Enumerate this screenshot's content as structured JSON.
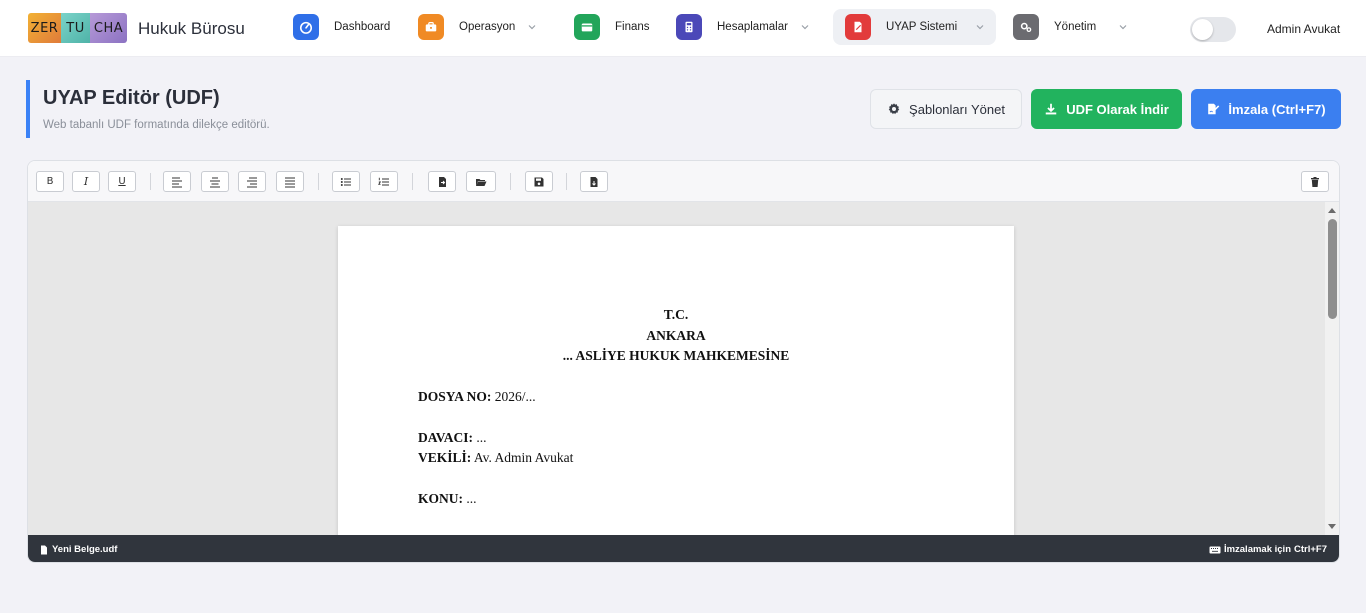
{
  "app": {
    "logo_parts": [
      "ZER",
      "TU",
      "CHA"
    ],
    "brand": "Hukuk Bürosu"
  },
  "nav": [
    {
      "label": "Dashboard",
      "icon": "gauge-icon",
      "color": "#2f6fe8",
      "dropdown": false
    },
    {
      "label": "Operasyon",
      "icon": "briefcase-icon",
      "color": "#f08a24",
      "dropdown": true
    },
    {
      "label": "Finans",
      "icon": "wallet-icon",
      "color": "#22a55a",
      "dropdown": false
    },
    {
      "label": "Hesaplamalar",
      "icon": "calculator-icon",
      "color": "#4b48b8",
      "dropdown": true
    },
    {
      "label": "UYAP Sistemi",
      "icon": "file-signature-icon",
      "color": "#e23b3b",
      "dropdown": true,
      "active": true
    },
    {
      "label": "Yönetim",
      "icon": "cogs-icon",
      "color": "#6b6b70",
      "dropdown": true
    }
  ],
  "user": {
    "name": "Admin Avukat",
    "theme_toggle_on": false
  },
  "page": {
    "title": "UYAP Editör (UDF)",
    "subtitle": "Web tabanlı UDF formatında dilekçe editörü."
  },
  "actions": {
    "templates": "Şablonları Yönet",
    "download": "UDF Olarak İndir",
    "sign": "İmzala (Ctrl+F7)"
  },
  "toolbar": {
    "bold": "B",
    "italic": "I",
    "underline": "U"
  },
  "document": {
    "line1": "T.C.",
    "line2": "ANKARA",
    "line3": "... ASLİYE HUKUK MAHKEMESİNE",
    "dosya_label": "DOSYA NO:",
    "dosya_value": " 2026/...",
    "davaci_label": "DAVACI:",
    "davaci_value": " ...",
    "vekili_label": "VEKİLİ:",
    "vekili_value": " Av. Admin Avukat",
    "konu_label": "KONU:",
    "konu_value": " ..."
  },
  "status": {
    "filename": "Yeni Belge.udf",
    "hint": "İmzalamak için ",
    "hint_key": "Ctrl+F7"
  }
}
